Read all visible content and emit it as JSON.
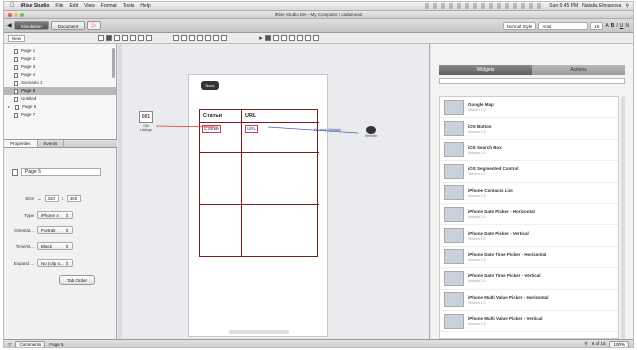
{
  "menubar": {
    "app": "iRise Studio",
    "items": [
      "File",
      "Edit",
      "View",
      "Format",
      "Tools",
      "Help"
    ],
    "clock": "Sun 6:45 PM",
    "user": "Natalia Elmanova"
  },
  "window": {
    "title": "iRise Studio MA - My Computer / cadamea2"
  },
  "toolbar": {
    "simulation_tab": "Simulation",
    "document_tab": "Document",
    "play_glyph": "▷",
    "style_select": "Normal Style",
    "font_select": "Arial",
    "size_select": "15",
    "format_glyphs": [
      "A",
      "B",
      "I",
      "U",
      "N"
    ]
  },
  "toolbar2": {
    "page_selector": "New"
  },
  "sitemap": {
    "items": [
      {
        "label": "Page 1"
      },
      {
        "label": "Page 2"
      },
      {
        "label": "Page 3"
      },
      {
        "label": "Page 4"
      },
      {
        "label": "Scenario 1"
      },
      {
        "label": "Page 5"
      },
      {
        "label": "Untitled"
      },
      {
        "label": "Page 6"
      },
      {
        "label": "Page 7"
      }
    ]
  },
  "panel_tabs": {
    "properties": "Properties",
    "events": "Events"
  },
  "properties": {
    "page_name": "Page 5",
    "size_label": "Size",
    "size_w": "320",
    "size_h": "460",
    "type_label": "Type",
    "type_value": "iPhone 4",
    "orient_label": "Orientat...",
    "orient_value": "Portrait",
    "time_label": "Time/st...",
    "time_value": "Black",
    "expand_label": "Expand ...",
    "expand_value": "No (clip o...",
    "tab_order": "Tab Order"
  },
  "canvas": {
    "back_button": "Back",
    "table_header_1": "Статьи",
    "table_header_2": "URL",
    "cell_1": "Статьи",
    "cell_2": "URL",
    "widget_label": "Get Listings",
    "widget_number": "001",
    "connector_label": "On click: Website",
    "target_label": "Website"
  },
  "right_panel": {
    "widgets_tab": "Widgets",
    "actions_tab": "Actions",
    "widgets": [
      {
        "name": "Google Map",
        "sub": "Version 1.0"
      },
      {
        "name": "iOS Button",
        "sub": "Version 1.0"
      },
      {
        "name": "iOS Search Box",
        "sub": "Version 1.0"
      },
      {
        "name": "iOS Segmented Control",
        "sub": "Version 1.0"
      },
      {
        "name": "iPhone Contacts List",
        "sub": "Version 1.0"
      },
      {
        "name": "iPhone Date Picker - Horizontal",
        "sub": "Version 1.0"
      },
      {
        "name": "iPhone Date Picker - Vertical",
        "sub": "Version 1.0"
      },
      {
        "name": "iPhone Date Time Picker - Horizontal",
        "sub": "Version 1.0"
      },
      {
        "name": "iPhone Date Time Picker - Vertical",
        "sub": "Version 1.0"
      },
      {
        "name": "iPhone Multi Value Picker - Horizontal",
        "sub": "Version 1.0"
      },
      {
        "name": "iPhone Multi Value Picker - Vertical",
        "sub": "Version 1.0"
      }
    ]
  },
  "statusbar": {
    "comments": "Comments",
    "page": "Page 5",
    "page_count": "6 of 15",
    "zoom": "100%"
  }
}
